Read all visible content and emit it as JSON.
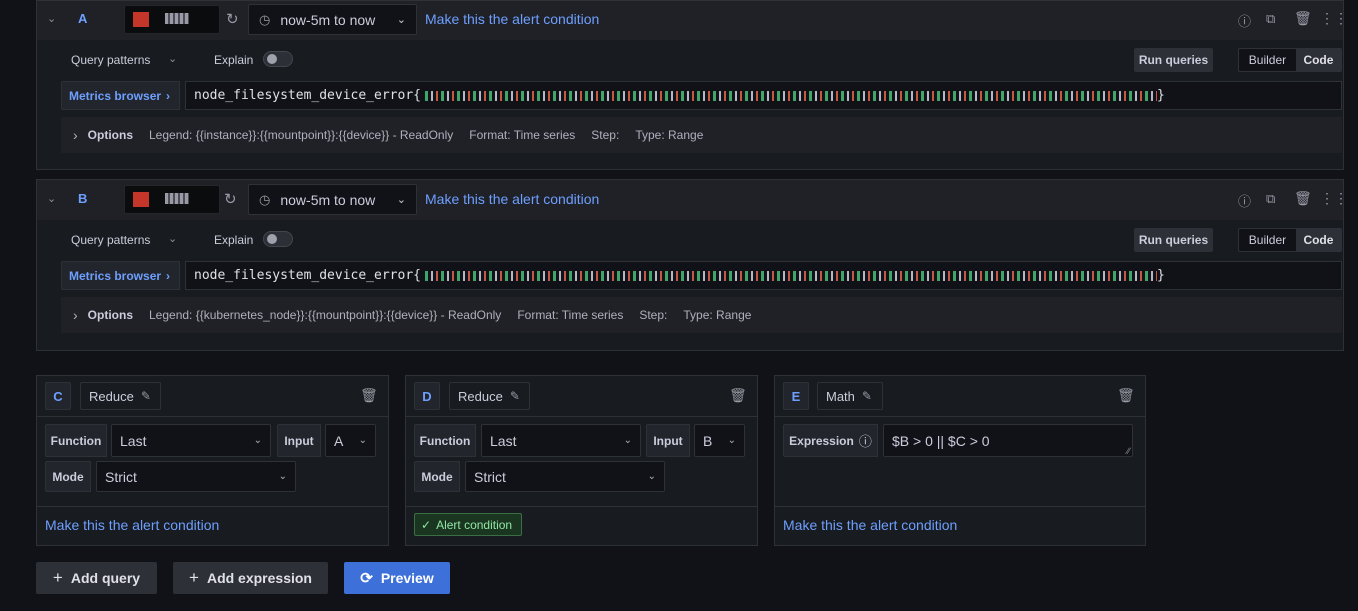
{
  "queries": [
    {
      "letter": "A",
      "time_range": "now-5m to now",
      "alert_link": "Make this the alert condition",
      "query_patterns": "Query patterns",
      "explain": "Explain",
      "run_queries": "Run queries",
      "builder": "Builder",
      "code": "Code",
      "metrics_browser": "Metrics browser",
      "query_prefix": "node_filesystem_device_error{",
      "query_suffix": " }",
      "options_label": "Options",
      "legend": "Legend: {{instance}}:{{mountpoint}}:{{device}} - ReadOnly",
      "format": "Format: Time series",
      "step": "Step:",
      "type": "Type: Range"
    },
    {
      "letter": "B",
      "time_range": "now-5m to now",
      "alert_link": "Make this the alert condition",
      "query_patterns": "Query patterns",
      "explain": "Explain",
      "run_queries": "Run queries",
      "builder": "Builder",
      "code": "Code",
      "metrics_browser": "Metrics browser",
      "query_prefix": "node_filesystem_device_error{",
      "query_suffix": "}",
      "options_label": "Options",
      "legend": "Legend: {{kubernetes_node}}:{{mountpoint}}:{{device}} - ReadOnly",
      "format": "Format: Time series",
      "step": "Step:",
      "type": "Type: Range"
    }
  ],
  "expressions": [
    {
      "letter": "C",
      "type": "Reduce",
      "function_label": "Function",
      "function_value": "Last",
      "input_label": "Input",
      "input_value": "A",
      "mode_label": "Mode",
      "mode_value": "Strict",
      "footer": "Make this the alert condition"
    },
    {
      "letter": "D",
      "type": "Reduce",
      "function_label": "Function",
      "function_value": "Last",
      "input_label": "Input",
      "input_value": "B",
      "mode_label": "Mode",
      "mode_value": "Strict",
      "footer": "Alert condition"
    },
    {
      "letter": "E",
      "type": "Math",
      "expression_label": "Expression",
      "expression_value": "$B > 0 || $C > 0",
      "footer": "Make this the alert condition"
    }
  ],
  "buttons": {
    "add_query": "Add query",
    "add_expression": "Add expression",
    "preview": "Preview"
  },
  "colors": {
    "accent": "#6e9fff",
    "primary": "#3d71d9",
    "success": "#8fe6a3"
  }
}
